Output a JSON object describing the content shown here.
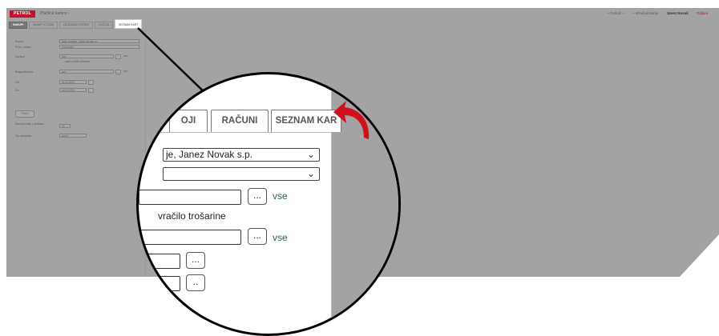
{
  "header": {
    "logo": "PETROL",
    "title": "Plačilne kartice -",
    "links": [
      "« Pomoč »",
      "» eRačunovanje",
      "Janez Novak",
      "Odjava"
    ]
  },
  "tabs": [
    "NAKUPI",
    "NAKUP V TUJINI",
    "IZDAJANJE OPRIEE",
    "RAČUNI",
    "SEZNAM KART"
  ],
  "form": {
    "kupec_label": "Kupec:",
    "kupec_value": "Moje podjetje, Janez Novak s.p.",
    "prod_mesto_label": "Prod. mesto:",
    "prod_mesto_value": "Vsi servisi",
    "kartica_label": "Kartica:",
    "kartica_value": "vse",
    "kartica_link": "vse",
    "vracilo_label": "samo vračilo trošarine",
    "blagovni_label": "Blagovikartice:",
    "blagovni_value": "vse",
    "blagovni_link": "vse",
    "od_label": "Od:",
    "od_value": "01.11.2022",
    "do_label": "Do:",
    "do_value": "14.01.2023",
    "iskanje_button": "Poišči",
    "stevilo_label": "Število vrstic v prikazu:",
    "stevilo_value": "40",
    "tip_label": "Tip datoteke:",
    "tip_value": "excel"
  },
  "zoom": {
    "tabs": [
      "OJI",
      "RAČUNI",
      "SEZNAM KAR"
    ],
    "kupec_value": "je, Janez Novak s.p.",
    "prod_mesto_value": "",
    "kartica_link": "vse",
    "vracilo_text": "vračilo trošarine",
    "blagovni_link": "vse",
    "btn_label": "...",
    "btn_label_partial": ".."
  },
  "colors": {
    "brand_red": "#c8102e",
    "screen_grey": "#a2a3a2",
    "link_teal": "#2f5f5f"
  }
}
